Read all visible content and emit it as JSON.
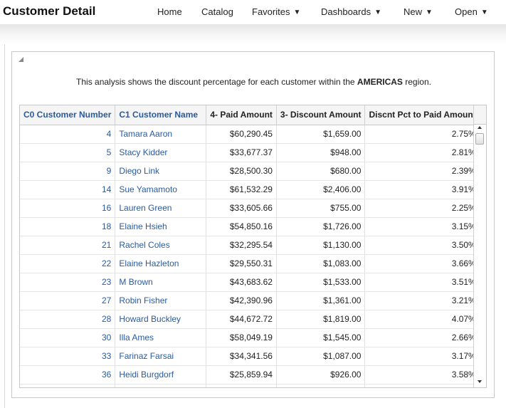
{
  "header": {
    "title": "Customer Detail",
    "nav": [
      {
        "label": "Home",
        "dropdown": false
      },
      {
        "label": "Catalog",
        "dropdown": false
      },
      {
        "label": "Favorites",
        "dropdown": true
      },
      {
        "label": "Dashboards",
        "dropdown": true
      },
      {
        "label": "New",
        "dropdown": true
      },
      {
        "label": "Open",
        "dropdown": true
      }
    ],
    "caret": "▼"
  },
  "analysis": {
    "desc_prefix": "This analysis shows the discount percentage for each customer within the ",
    "desc_region": "AMERICAS",
    "desc_suffix": " region."
  },
  "table": {
    "columns": [
      "C0 Customer Number",
      "C1 Customer Name",
      "4- Paid Amount",
      "3- Discount Amount",
      "Discnt Pct to Paid Amount"
    ],
    "rows": [
      [
        "4",
        "Tamara Aaron",
        "$60,290.45",
        "$1,659.00",
        "2.75%"
      ],
      [
        "5",
        "Stacy Kidder",
        "$33,677.37",
        "$948.00",
        "2.81%"
      ],
      [
        "9",
        "Diego Link",
        "$28,500.30",
        "$680.00",
        "2.39%"
      ],
      [
        "14",
        "Sue Yamamoto",
        "$61,532.29",
        "$2,406.00",
        "3.91%"
      ],
      [
        "16",
        "Lauren Green",
        "$33,605.66",
        "$755.00",
        "2.25%"
      ],
      [
        "18",
        "Elaine Hsieh",
        "$54,850.16",
        "$1,726.00",
        "3.15%"
      ],
      [
        "21",
        "Rachel Coles",
        "$32,295.54",
        "$1,130.00",
        "3.50%"
      ],
      [
        "22",
        "Elaine Hazleton",
        "$29,550.31",
        "$1,083.00",
        "3.66%"
      ],
      [
        "23",
        "M Brown",
        "$43,683.62",
        "$1,533.00",
        "3.51%"
      ],
      [
        "27",
        "Robin Fisher",
        "$42,390.96",
        "$1,361.00",
        "3.21%"
      ],
      [
        "28",
        "Howard Buckley",
        "$44,672.72",
        "$1,819.00",
        "4.07%"
      ],
      [
        "30",
        "Illa Ames",
        "$58,049.19",
        "$1,545.00",
        "2.66%"
      ],
      [
        "33",
        "Farinaz Farsai",
        "$34,341.56",
        "$1,087.00",
        "3.17%"
      ],
      [
        "36",
        "Heidi Burgdorf",
        "$25,859.94",
        "$926.00",
        "3.58%"
      ],
      [
        "",
        "",
        "",
        "",
        ""
      ]
    ]
  },
  "icons": {
    "collapse": "triangle-icon",
    "scroll_up": "arrow-up-icon",
    "scroll_down": "arrow-down-icon"
  },
  "colors": {
    "link": "#2a5a9c",
    "header_bg": "#f5f5f5",
    "border": "#c8c8c8"
  }
}
